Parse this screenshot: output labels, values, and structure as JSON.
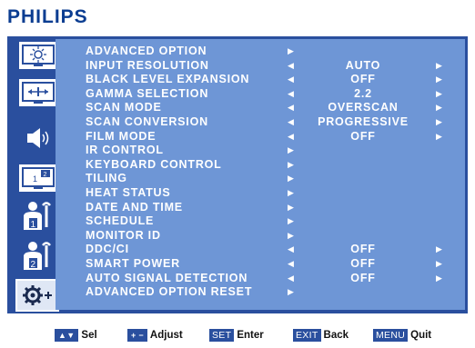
{
  "brand": "PHILIPS",
  "sidebar": [
    {
      "icon": "brightness-icon"
    },
    {
      "icon": "screen-adjust-icon"
    },
    {
      "icon": "speaker-icon"
    },
    {
      "icon": "pip-icon",
      "badge": "1",
      "badge2": "2"
    },
    {
      "icon": "config1-icon",
      "badge": "1"
    },
    {
      "icon": "config2-icon",
      "badge": "2"
    },
    {
      "icon": "advanced-settings-icon"
    }
  ],
  "menu": [
    {
      "label": "ADVANCED OPTION",
      "value": "",
      "arrows": "sub"
    },
    {
      "label": "INPUT RESOLUTION",
      "value": "AUTO",
      "arrows": "both"
    },
    {
      "label": "BLACK LEVEL EXPANSION",
      "value": "OFF",
      "arrows": "both"
    },
    {
      "label": "GAMMA SELECTION",
      "value": "2.2",
      "arrows": "both"
    },
    {
      "label": "SCAN MODE",
      "value": "OVERSCAN",
      "arrows": "both"
    },
    {
      "label": "SCAN CONVERSION",
      "value": "PROGRESSIVE",
      "arrows": "both"
    },
    {
      "label": "FILM MODE",
      "value": "OFF",
      "arrows": "both"
    },
    {
      "label": "IR CONTROL",
      "value": "",
      "arrows": "sub"
    },
    {
      "label": "KEYBOARD CONTROL",
      "value": "",
      "arrows": "sub"
    },
    {
      "label": "TILING",
      "value": "",
      "arrows": "sub"
    },
    {
      "label": "HEAT STATUS",
      "value": "",
      "arrows": "sub"
    },
    {
      "label": "DATE AND TIME",
      "value": "",
      "arrows": "sub"
    },
    {
      "label": "SCHEDULE",
      "value": "",
      "arrows": "sub"
    },
    {
      "label": "MONITOR ID",
      "value": "",
      "arrows": "sub"
    },
    {
      "label": "DDC/CI",
      "value": "OFF",
      "arrows": "both"
    },
    {
      "label": "SMART POWER",
      "value": "OFF",
      "arrows": "both"
    },
    {
      "label": "AUTO SIGNAL DETECTION",
      "value": "OFF",
      "arrows": "both"
    },
    {
      "label": "ADVANCED OPTION RESET",
      "value": "",
      "arrows": "sub"
    }
  ],
  "footer": [
    {
      "key": "▲▼",
      "text": "Sel"
    },
    {
      "key": "+ −",
      "text": "Adjust"
    },
    {
      "key": "SET",
      "text": "Enter"
    },
    {
      "key": "EXIT",
      "text": "Back"
    },
    {
      "key": "MENU",
      "text": "Quit"
    }
  ],
  "colors": {
    "osd_frame": "#2a4f9e",
    "menu_bg": "#6e96d6",
    "brand": "#0b3d91"
  }
}
